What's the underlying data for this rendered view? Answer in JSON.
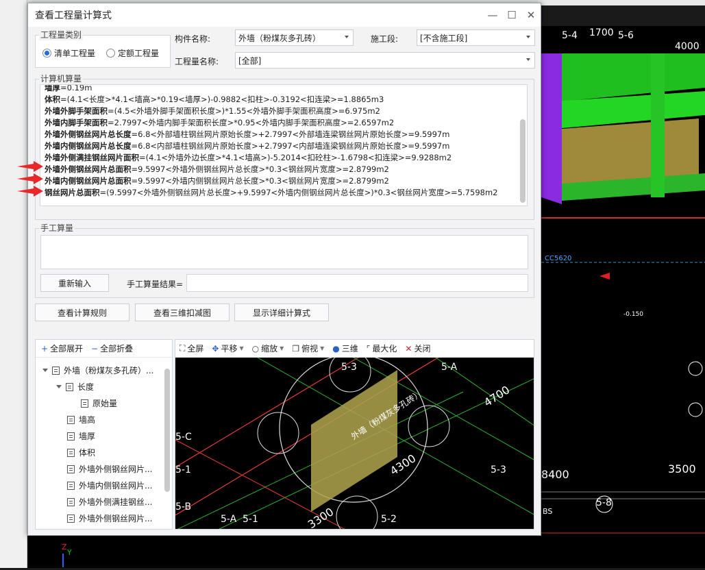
{
  "dialog": {
    "title": "查看工程量计算式",
    "min": "—",
    "max": "☐",
    "close": "✕"
  },
  "category": {
    "legend": "工程量类别",
    "option1": "清单工程量",
    "option2": "定额工程量",
    "selected": "清单工程量"
  },
  "fields": {
    "component_label": "构件名称:",
    "component_value": "外墙（粉煤灰多孔砖）",
    "stage_label": "施工段:",
    "stage_value": "[不含施工段]",
    "quantity_label": "工程量名称:",
    "quantity_value": "[全部]"
  },
  "computer_calc": {
    "legend": "计算机算量",
    "lines": [
      {
        "name": "墙厚",
        "expr": "=0.19m"
      },
      {
        "name": "体积",
        "expr": "=(4.1<长度>*4.1<墙高>*0.19<墙厚>)-0.9882<扣柱>-0.3192<扣连梁>=1.8865m3"
      },
      {
        "name": "外墙外脚手架面积",
        "expr": "=(4.5<外墙外脚手架面积长度>)*1.55<外墙外脚手架面积高度>=6.975m2"
      },
      {
        "name": "外墙内脚手架面积",
        "expr": "=2.7997<外墙内脚手架面积长度>*0.95<外墙内脚手架面积高度>=2.6597m2"
      },
      {
        "name": "外墙外侧钢丝网片总长度",
        "expr": "=6.8<外部墙柱钢丝网片原始长度>+2.7997<外部墙连梁钢丝网片原始长度>=9.5997m"
      },
      {
        "name": "外墙内侧钢丝网片总长度",
        "expr": "=6.8<内部墙柱钢丝网片原始长度>+2.7997<内部墙连梁钢丝网片原始长度>=9.5997m"
      },
      {
        "name": "外墙外侧满挂钢丝网片面积",
        "expr": "=(4.1<外墙外边长度>*4.1<墙高>)-5.2014<扣砼柱>-1.6798<扣连梁>=9.9288m2"
      },
      {
        "name": "外墙外侧钢丝网片总面积",
        "expr": "=9.5997<外墙外侧钢丝网片总长度>*0.3<钢丝网片宽度>=2.8799m2"
      },
      {
        "name": "外墙内侧钢丝网片总面积",
        "expr": "=9.5997<外墙内侧钢丝网片总长度>*0.3<钢丝网片宽度>=2.8799m2"
      },
      {
        "name": "钢丝网片总面积",
        "expr": "=(9.5997<外墙外侧钢丝网片总长度>+9.5997<外墙内侧钢丝网片总长度>)*0.3<钢丝网片宽度>=5.7598m2"
      }
    ]
  },
  "manual_calc": {
    "legend": "手工算量",
    "reset_button": "重新输入",
    "result_label": "手工算量结果="
  },
  "buttons": {
    "rules": "查看计算规则",
    "deduct3d": "查看三维扣减图",
    "detail": "显示详细计算式"
  },
  "tree": {
    "expand_all": "全部展开",
    "collapse_all": "全部折叠",
    "items": [
      {
        "label": "外墙（粉煤灰多孔砖）..."
      },
      {
        "label": "长度"
      },
      {
        "label": "原始量"
      },
      {
        "label": "墙高"
      },
      {
        "label": "墙厚"
      },
      {
        "label": "体积"
      },
      {
        "label": "外墙外侧钢丝网片..."
      },
      {
        "label": "外墙内侧钢丝网片..."
      },
      {
        "label": "外墙外侧满挂钢丝..."
      },
      {
        "label": "外墙外侧钢丝网片..."
      }
    ]
  },
  "viewer": {
    "toolbar": {
      "fullscreen": "全屏",
      "pan": "平移",
      "zoom": "缩放",
      "topview": "俯视",
      "threed": "三维",
      "maximize": "最大化",
      "close": "关闭"
    },
    "labels": {
      "axis_53_top": "5-3",
      "axis_5A_top": "5-A",
      "dim_4700": "4700",
      "axis_5C": "5-C",
      "axis_51_left": "5-1",
      "dim_4300": "4300",
      "axis_53_right": "5-3",
      "axis_5B": "5-B",
      "axis_5A_bottom": "5-A",
      "axis_51_bottom": "5-1",
      "dim_3300": "3300",
      "axis_52": "5-2",
      "wall_name": "外墙（粉煤灰多孔砖）"
    }
  },
  "background": {
    "cad_labels": {
      "t1": "5-4",
      "t2": "1700",
      "t3": "5-6",
      "t4": "4000",
      "t5": "8400",
      "t6": "3500",
      "t7": "5-8",
      "t8": "BS",
      "t9": "-0.150",
      "t10": "CC5620"
    }
  },
  "colors": {
    "arrow_red": "#e8282a",
    "accent_blue": "#1e6fd9"
  }
}
